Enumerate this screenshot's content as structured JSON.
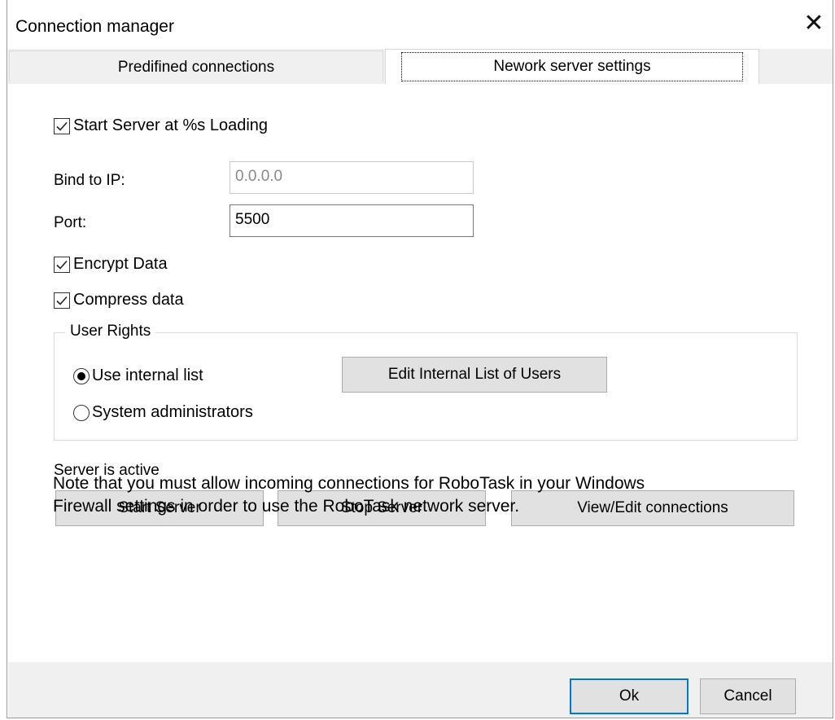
{
  "window": {
    "title": "Connection manager"
  },
  "tabs": [
    {
      "label": "Predifined connections"
    },
    {
      "label": "Nework server settings"
    }
  ],
  "server": {
    "start_at_loading_label": "Start Server at %s Loading",
    "bind_ip_label": "Bind to IP:",
    "bind_ip_value": "0.0.0.0",
    "port_label": "Port:",
    "port_value": "5500",
    "encrypt_label": "Encrypt Data",
    "compress_label": "Compress data"
  },
  "user_rights": {
    "title": "User Rights",
    "option_internal": "Use internal list",
    "option_admins": "System administrators",
    "edit_button": "Edit Internal List of Users"
  },
  "status": {
    "text": "Server is active"
  },
  "actions": {
    "start": "Start Server",
    "stop": "Stop Server",
    "view": "View/Edit connections"
  },
  "note": {
    "line1": "Note that you must allow incoming connections for RoboTask in your Windows",
    "line2": "Firewall settings in order to use the RoboTask network server."
  },
  "footer": {
    "ok": "Ok",
    "cancel": "Cancel"
  }
}
